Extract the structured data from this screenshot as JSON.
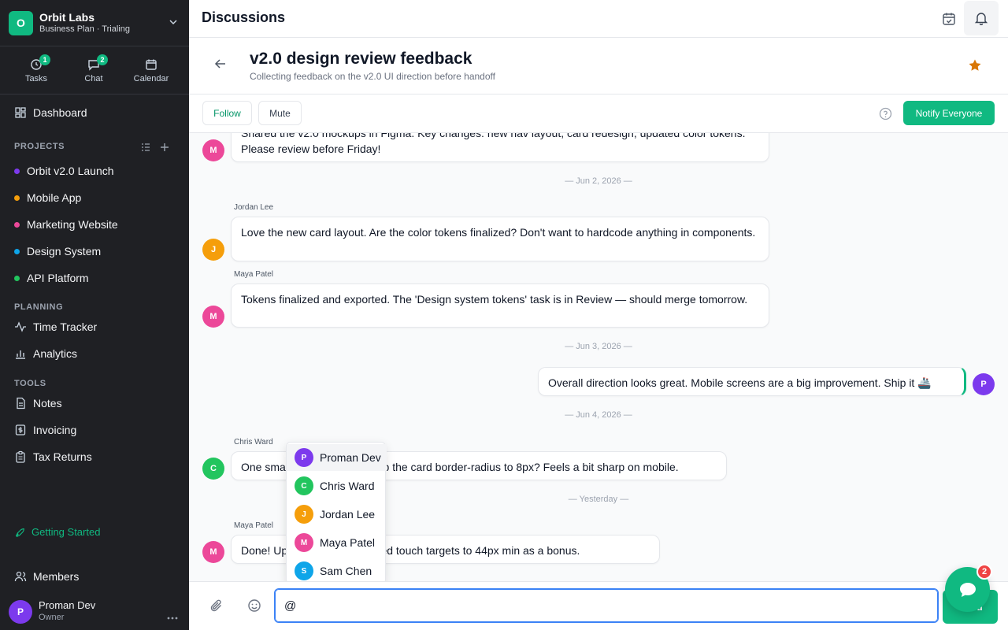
{
  "workspace": {
    "initial": "O",
    "name": "Orbit Labs",
    "plan": "Business Plan · Trialing"
  },
  "quick_nav": [
    {
      "label": "Tasks",
      "badge": "1",
      "icon": "clock-icon"
    },
    {
      "label": "Chat",
      "badge": "2",
      "icon": "chat-icon"
    },
    {
      "label": "Calendar",
      "icon": "calendar-icon"
    }
  ],
  "sidebar": {
    "dashboard": "Dashboard",
    "projects_heading": "PROJECTS",
    "projects": [
      {
        "label": "Orbit v2.0 Launch",
        "color": "#7c3aed"
      },
      {
        "label": "Mobile App",
        "color": "#f59e0b"
      },
      {
        "label": "Marketing Website",
        "color": "#ec4899"
      },
      {
        "label": "Design System",
        "color": "#0ea5e9"
      },
      {
        "label": "API Platform",
        "color": "#22c55e"
      }
    ],
    "planning_heading": "PLANNING",
    "planning": [
      "Time Tracker",
      "Analytics"
    ],
    "tools_heading": "TOOLS",
    "tools": [
      "Notes",
      "Invoicing",
      "Tax Returns"
    ],
    "getting_started": "Getting Started",
    "members": "Members"
  },
  "user": {
    "initial": "P",
    "name": "Proman Dev",
    "role": "Owner"
  },
  "topbar": {
    "title": "Discussions"
  },
  "discussion": {
    "title": "v2.0 design review feedback",
    "subtitle": "Collecting feedback on the v2.0 UI direction before handoff",
    "follow": "Follow",
    "mute": "Mute",
    "notify": "Notify Everyone"
  },
  "messages": [
    {
      "initial": "M",
      "text": "Shared the v2.0 mockups in Figma. Key changes: new nav layout, card redesign, updated color tokens. Please review before Friday!"
    },
    {
      "date": "— Jun 2, 2026 —"
    },
    {
      "author": "Jordan Lee",
      "initial": "J",
      "text": "Love the new card layout. Are the color tokens finalized? Don't want to hardcode anything in components."
    },
    {
      "author": "Maya Patel",
      "initial": "M",
      "text": "Tokens finalized and exported. The 'Design system tokens' task is in Review — should merge tomorrow."
    },
    {
      "date": "— Jun 3, 2026 —"
    },
    {
      "initial": "P",
      "text": "Overall direction looks great. Mobile screens are a big improvement. Ship it 🚢"
    },
    {
      "date": "— Jun 4, 2026 —"
    },
    {
      "author": "Chris Ward",
      "initial": "C",
      "text": "One small thing: can we bump the card border-radius to 8px? Feels a bit sharp on mobile."
    },
    {
      "date": "— Yesterday —"
    },
    {
      "author": "Maya Patel",
      "initial": "M",
      "text": "Done! Updated. Also increased touch targets to 44px min as a bonus."
    }
  ],
  "mention_list": [
    {
      "initial": "P",
      "name": "Proman Dev",
      "color": "#7c3aed"
    },
    {
      "initial": "C",
      "name": "Chris Ward",
      "color": "#22c55e"
    },
    {
      "initial": "J",
      "name": "Jordan Lee",
      "color": "#f59e0b"
    },
    {
      "initial": "M",
      "name": "Maya Patel",
      "color": "#ec4899"
    },
    {
      "initial": "S",
      "name": "Sam Chen",
      "color": "#0ea5e9"
    }
  ],
  "composer": {
    "value": "@",
    "send": "Send"
  },
  "chat_fab": {
    "badge": "2"
  },
  "colors": {
    "accent": "#10b981",
    "sidebar_bg": "#1f2024",
    "star": "#d97706"
  }
}
